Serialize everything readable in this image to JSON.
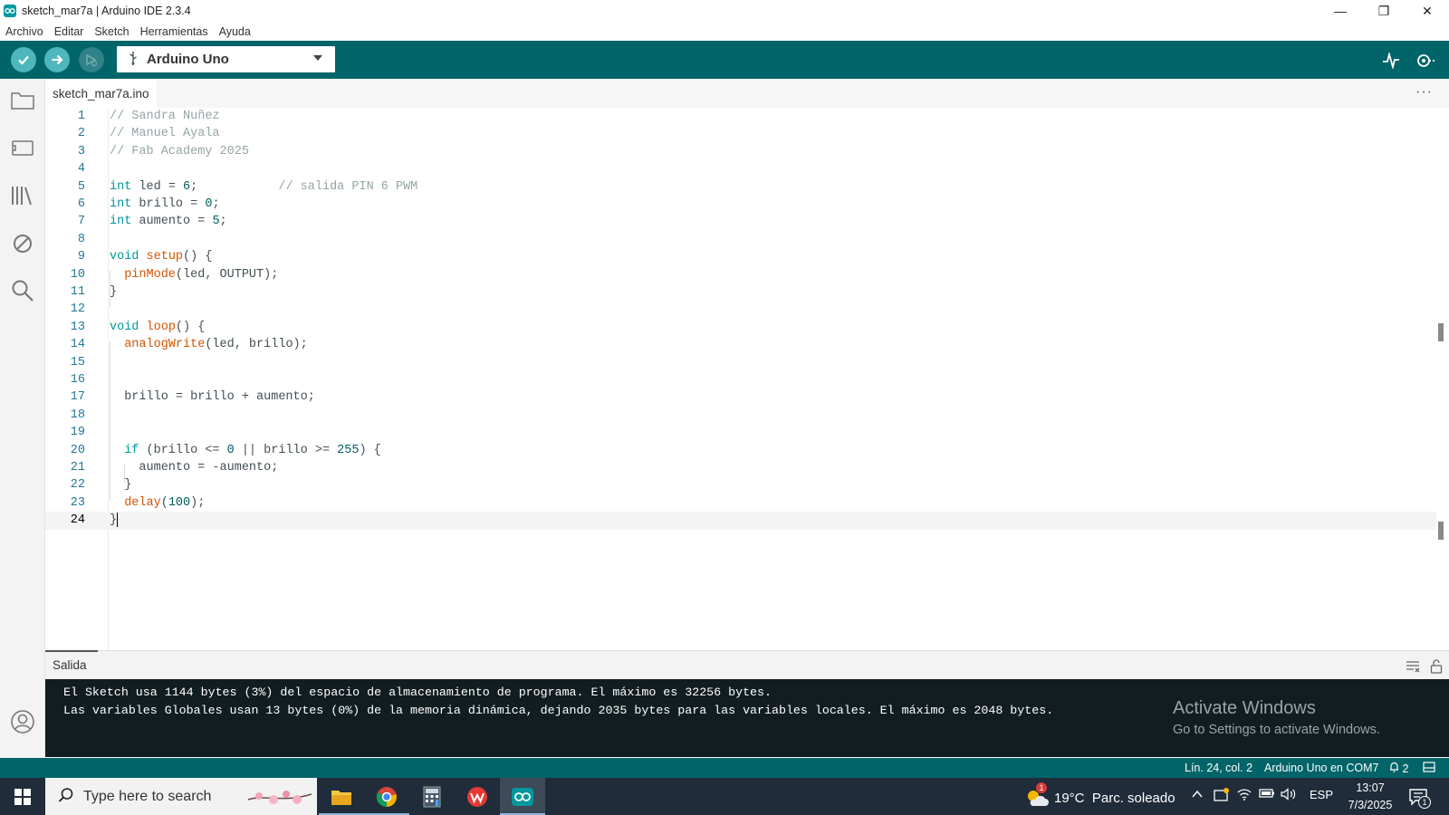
{
  "window": {
    "title": "sketch_mar7a | Arduino IDE 2.3.4",
    "controls": {
      "minimize": "—",
      "maximize": "❐",
      "close": "✕"
    }
  },
  "menu": [
    "Archivo",
    "Editar",
    "Sketch",
    "Herramientas",
    "Ayuda"
  ],
  "toolbar": {
    "verify_icon": "check-icon",
    "upload_icon": "arrow-right-icon",
    "debug_icon": "debug-icon",
    "board": "Arduino Uno",
    "serial_plotter_icon": "plotter-icon",
    "serial_monitor_icon": "monitor-icon"
  },
  "sidebar": [
    "folder-icon",
    "board-icon",
    "library-icon",
    "debug-disabled-icon",
    "search-icon",
    "account-icon"
  ],
  "editor": {
    "tab": "sketch_mar7a.ino",
    "more": "···",
    "lines": [
      {
        "n": "1",
        "code": "// Sandra Nuñez"
      },
      {
        "n": "2",
        "code": "// Manuel Ayala"
      },
      {
        "n": "3",
        "code": "// Fab Academy 2025"
      },
      {
        "n": "4",
        "code": ""
      },
      {
        "n": "5",
        "code": "int led = 6;           // salida PIN 6 PWM"
      },
      {
        "n": "6",
        "code": "int brillo = 0;"
      },
      {
        "n": "7",
        "code": "int aumento = 5;"
      },
      {
        "n": "8",
        "code": ""
      },
      {
        "n": "9",
        "code": "void setup() {"
      },
      {
        "n": "10",
        "code": "  pinMode(led, OUTPUT);"
      },
      {
        "n": "11",
        "code": "}"
      },
      {
        "n": "12",
        "code": ""
      },
      {
        "n": "13",
        "code": "void loop() {"
      },
      {
        "n": "14",
        "code": "  analogWrite(led, brillo);"
      },
      {
        "n": "15",
        "code": ""
      },
      {
        "n": "16",
        "code": ""
      },
      {
        "n": "17",
        "code": "  brillo = brillo + aumento;"
      },
      {
        "n": "18",
        "code": ""
      },
      {
        "n": "19",
        "code": ""
      },
      {
        "n": "20",
        "code": "  if (brillo <= 0 || brillo >= 255) {"
      },
      {
        "n": "21",
        "code": "    aumento = -aumento;"
      },
      {
        "n": "22",
        "code": "  }"
      },
      {
        "n": "23",
        "code": "  delay(100);"
      },
      {
        "n": "24",
        "code": "}"
      }
    ],
    "current_line": 24
  },
  "output": {
    "title": "Salida",
    "lines": [
      "El Sketch usa 1144 bytes (3%) del espacio de almacenamiento de programa. El máximo es 32256 bytes.",
      "Las variables Globales usan 13 bytes (0%) de la memoria dinámica, dejando 2035 bytes para las variables locales. El máximo es 2048 bytes."
    ],
    "watermark": {
      "title": "Activate Windows",
      "subtitle": "Go to Settings to activate Windows."
    }
  },
  "status": {
    "position": "Lín. 24, col. 2",
    "board_port": "Arduino Uno en COM7",
    "notifications": "2"
  },
  "taskbar": {
    "search_placeholder": "Type here to search",
    "weather": "19°C  Parc. soleado",
    "weather_badge": "1",
    "language": "ESP",
    "time": "13:07",
    "date": "7/3/2025",
    "notif_count": "1"
  },
  "colors": {
    "teal_dark": "#006468",
    "teal": "#00979d",
    "console_bg": "#111d20",
    "taskbar_bg": "#202c3a"
  }
}
